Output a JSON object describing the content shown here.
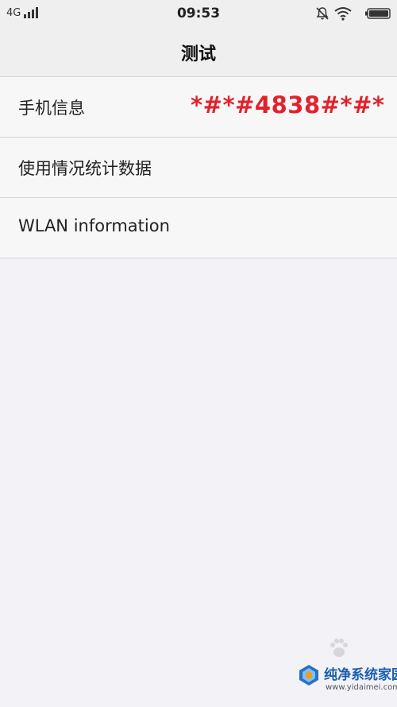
{
  "status_bar": {
    "network": "4G",
    "time": "09:53",
    "icons": [
      "signal-icon",
      "bell-off-icon",
      "wifi-icon",
      "battery-icon"
    ]
  },
  "nav": {
    "title": "测试"
  },
  "list": {
    "items": [
      {
        "label": "手机信息"
      },
      {
        "label": "使用情况统计数据"
      },
      {
        "label": "WLAN information"
      }
    ]
  },
  "annotation": {
    "text": "*#*#4838#*#*",
    "color": "#e2222b"
  },
  "watermark": {
    "title": "纯净系统家园",
    "url": "www.yidaimei.com"
  }
}
